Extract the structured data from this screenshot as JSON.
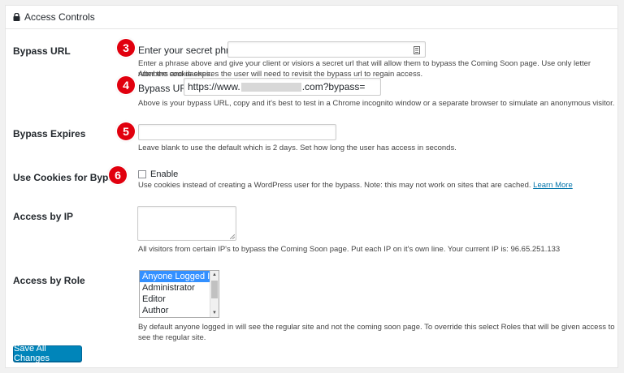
{
  "header": {
    "title": "Access Controls"
  },
  "bypass_url": {
    "label": "Bypass URL",
    "badge_phrase": "3",
    "phrase_label": "Enter your secret phrase:",
    "phrase_value": "",
    "phrase_desc_1": "Enter a phrase above and give your client or visiors a secret url that will allow them to bypass the Coming Soon page. Use only letter numbers and dashes.",
    "phrase_desc_2": "After the cookie expires the user will need to revisit the bypass url to regain access.",
    "badge_url": "4",
    "url_label": "Bypass URL:",
    "url_prefix": "https://www.",
    "url_suffix": ".com?bypass=",
    "url_desc": "Above is your bypass URL, copy and it's best to test in a Chrome incognito window or a separate browser to simulate an anonymous visitor."
  },
  "bypass_expires": {
    "label": "Bypass Expires",
    "badge": "5",
    "value": "",
    "desc": "Leave blank to use the default which is 2 days. Set how long the user has access in seconds."
  },
  "cookies": {
    "label": "Use Cookies for Bypass",
    "badge": "6",
    "checkbox_label": "Enable",
    "checked": false,
    "desc": "Use cookies instead of creating a WordPress user for the bypass. Note: this may not work on sites that are cached.",
    "link": "Learn More"
  },
  "access_ip": {
    "label": "Access by IP",
    "value": "",
    "desc": "All visitors from certain IP's to bypass the Coming Soon page. Put each IP on it's own line. Your current IP is: 96.65.251.133"
  },
  "access_role": {
    "label": "Access by Role",
    "options": [
      "Anyone Logged In",
      "Administrator",
      "Editor",
      "Author"
    ],
    "selected": "Anyone Logged In",
    "desc": "By default anyone logged in will see the regular site and not the coming soon page. To override this select Roles that will be given access to see the regular site."
  },
  "save_button": "Save All Changes",
  "colors": {
    "accent": "#0085ba",
    "badge": "#e1000e",
    "selection": "#3390ff",
    "link": "#0073aa"
  }
}
